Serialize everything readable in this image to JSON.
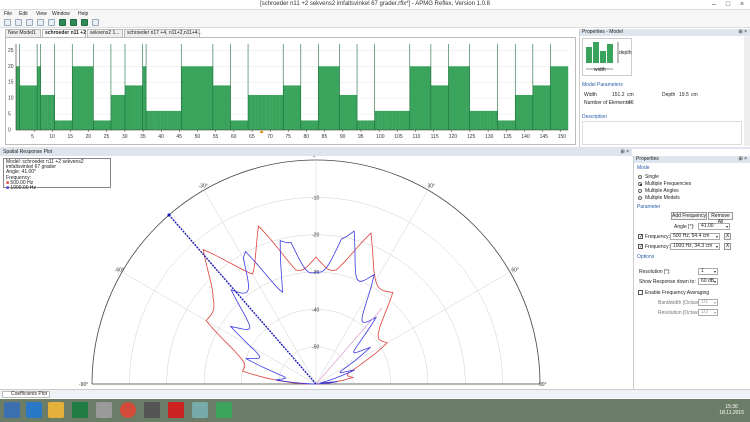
{
  "window": {
    "title": "[schroeder n11 +2    sekvens2 imfaltsvinkel 67 grader.rflx*] - APMG Reflex, Version 1.0.8"
  },
  "menu": [
    "File",
    "Edit",
    "View",
    "Window",
    "Help"
  ],
  "tabs": [
    "New Model1",
    "schroeder n11 +2",
    "sekvens2 1...",
    "schroeder n17 +4, n11+2,n11+4..."
  ],
  "model_view": {
    "y_ticks": [
      "0",
      "5",
      "10",
      "15",
      "20",
      "25"
    ],
    "x_ticks": [
      "5",
      "10",
      "15",
      "20",
      "25",
      "30",
      "35",
      "40",
      "45",
      "50",
      "55",
      "60",
      "65",
      "70",
      "75",
      "80",
      "85",
      "90",
      "95",
      "100",
      "105",
      "110",
      "115",
      "120",
      "125",
      "130",
      "135",
      "140",
      "145",
      "150"
    ],
    "wells": [
      20,
      14,
      14,
      14,
      14,
      14,
      20,
      11,
      11,
      11,
      11,
      3,
      3,
      3,
      3,
      3,
      20,
      20,
      20,
      20,
      20,
      20,
      3,
      3,
      3,
      3,
      3,
      11,
      11,
      11,
      11,
      14,
      14,
      14,
      14,
      14,
      20,
      6,
      6,
      6,
      6,
      6,
      6,
      6,
      6,
      6,
      6,
      20,
      20,
      20,
      20,
      20,
      20,
      20,
      20,
      20,
      14,
      14,
      14,
      14,
      14,
      3,
      3,
      3,
      3,
      3,
      11,
      11,
      11,
      11,
      11,
      11,
      11,
      11,
      11,
      11,
      14,
      14,
      14,
      14,
      14,
      3,
      3,
      3,
      3,
      3,
      20,
      20,
      20,
      20,
      20,
      20,
      11,
      11,
      11,
      11,
      11,
      3,
      3,
      3,
      3,
      3,
      6,
      6,
      6,
      6,
      6,
      6,
      6,
      6,
      6,
      6,
      20,
      20,
      20,
      20,
      20,
      20,
      14,
      14,
      14,
      14,
      14,
      20,
      20,
      20,
      20,
      20,
      20,
      6,
      6,
      6,
      6,
      6,
      6,
      6,
      6,
      3,
      3,
      3,
      3,
      3,
      11,
      11,
      11,
      11,
      11,
      14,
      14,
      14,
      14,
      14,
      20,
      20,
      20,
      20,
      20
    ]
  },
  "properties": {
    "header": "Properties - Model",
    "diagram": {
      "width_label": "width",
      "depth_label": "depth"
    },
    "model_params_label": "Model Parameters",
    "width_label": "Width",
    "width_value": "151.2",
    "width_unit": "cm",
    "depth_label": "Depth",
    "depth_value": "19.5",
    "depth_unit": "cm",
    "elements_label": "Number of Elements:",
    "elements_value": "46",
    "description_label": "Description"
  },
  "spatial": {
    "header": "Spatial Response Plot",
    "legend": {
      "model_label": "Model:",
      "model_value": "schroeder n11 +2    sekvens2 imfaltsvinkel 67 grader",
      "angle_label": "Angle:",
      "angle_value": "41.00°",
      "freq_label": "Frequency:",
      "f1": "500.00 Hz",
      "f2": "1000.00 Hz"
    },
    "angle_labels": [
      "0°",
      "30°",
      "60°",
      "90°",
      "-30°",
      "-60°",
      "-90°"
    ],
    "ring_labels": [
      "-10",
      "-20",
      "-30",
      "-40",
      "-50"
    ]
  },
  "colors": {
    "f1": "#e0403c",
    "f2": "#3a3ae0",
    "incidence": "#1d1db3",
    "bar": "#3aa45c"
  },
  "chart_data": {
    "type": "polar",
    "angle_range_deg": [
      -90,
      90
    ],
    "radial_range_db": [
      -60,
      0
    ],
    "incidence_angle_deg": -41,
    "series": [
      {
        "name": "500.00 Hz",
        "angles_deg": [
          -90,
          -80,
          -70,
          -60,
          -50,
          -40,
          -30,
          -20,
          -10,
          0,
          10,
          20,
          30,
          40,
          50,
          60,
          70,
          80,
          90
        ],
        "db": [
          -56,
          -44,
          -36,
          -30,
          -22,
          -17,
          -24,
          -19,
          -27,
          -30,
          -27,
          -21,
          -26,
          -32,
          -36,
          -42,
          -48,
          -54,
          -58
        ]
      },
      {
        "name": "1000.00 Hz",
        "angles_deg": [
          -90,
          -80,
          -70,
          -60,
          -50,
          -40,
          -30,
          -20,
          -10,
          0,
          10,
          20,
          30,
          40,
          50,
          60,
          70,
          80,
          90
        ],
        "db": [
          -58,
          -50,
          -44,
          -38,
          -34,
          -29,
          -22,
          -31,
          -20,
          -34,
          -19,
          -26,
          -32,
          -39,
          -44,
          -48,
          -53,
          -57,
          -60
        ]
      }
    ]
  },
  "right": {
    "header": "Properties",
    "mode_label": "Mode",
    "modes": [
      "Single",
      "Multiple Frequencies",
      "Multiple Angles",
      "Multiple Models"
    ],
    "param_label": "Parameter",
    "add_freq": "Add Frequency",
    "remove_all": "Remove All",
    "angle_label": "Angle [°]:",
    "angle_value": "41.00",
    "freq_label": "Frequency:",
    "freq1": "500 Hz,  54.4 cm",
    "freq2": "1000 Hz,  34.3 cm",
    "x": "X",
    "options_label": "Options",
    "resolution_label": "Resolution [°]:",
    "resolution_value": "1",
    "response_label": "Show Response down to:",
    "response_value": "60 dB",
    "averaging_label": "Enable Frequency Averaging",
    "bandwidth_label": "Bandwidth [Octave]:",
    "bandwidth_value": "1/1",
    "resolution_oct_label": "Resolution [Octave]:",
    "resolution_oct_value": "1/3"
  },
  "bottom_tab": "Coefficients Plot",
  "clock": {
    "time": "15:36",
    "date": "18.11.2015"
  }
}
